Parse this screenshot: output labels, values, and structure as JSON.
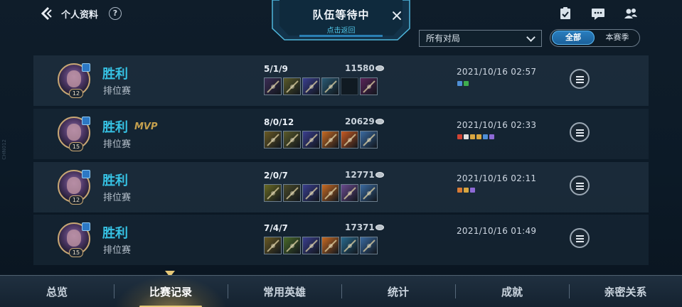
{
  "header": {
    "title": "个人资料",
    "help_label": "?"
  },
  "team_banner": {
    "title": "队伍等待中",
    "subtitle": "点击返回"
  },
  "filters": {
    "match_type_selected": "所有对局",
    "segments": [
      {
        "label": "全部",
        "active": true
      },
      {
        "label": "本赛季",
        "active": false
      }
    ]
  },
  "side_watermark": "CHN012",
  "matches": [
    {
      "result": "胜利",
      "mvp": "",
      "mode": "排位赛",
      "level": "12",
      "kda": "5/1/9",
      "gold": "11580",
      "date": "2021/10/16 02:57",
      "items": [
        "#3b2d55",
        "#5a5a2a",
        "#3a3e8e",
        "#2a5a73",
        "empty",
        "#5a2458"
      ],
      "badges": [
        "#4f8fd6",
        "#3fae4e"
      ]
    },
    {
      "result": "胜利",
      "mvp": "MVP",
      "mode": "排位赛",
      "level": "15",
      "kda": "8/0/12",
      "gold": "20629",
      "date": "2021/10/16 02:33",
      "items": [
        "#6a5a24",
        "#5a5a2a",
        "#3a3e8e",
        "#c86a22",
        "#c85a22",
        "#3a6aa0"
      ],
      "badges": [
        "#d24434",
        "#e0e0e0",
        "#d8a640",
        "#d8a640",
        "#4f8fd6",
        "#8e6ad6"
      ]
    },
    {
      "result": "胜利",
      "mvp": "",
      "mode": "排位赛",
      "level": "12",
      "kda": "2/0/7",
      "gold": "12771",
      "date": "2021/10/16 02:11",
      "items": [
        "#6a6a24",
        "#4a4a2a",
        "#3a3e8e",
        "#c86a22",
        "#6a4a8e",
        "#3a6aa0"
      ],
      "badges": [
        "#d87a34",
        "#d8a640",
        "#8e6ad6"
      ]
    },
    {
      "result": "胜利",
      "mvp": "",
      "mode": "排位赛",
      "level": "15",
      "kda": "7/4/7",
      "gold": "17371",
      "date": "2021/10/16 01:49",
      "items": [
        "#6a5a24",
        "#4a6a2a",
        "#3a3e8e",
        "#c86a22",
        "#2a6a8e",
        "#3a6aa0"
      ],
      "badges": []
    }
  ],
  "tabs": [
    {
      "label": "总览",
      "active": false
    },
    {
      "label": "比赛记录",
      "active": true
    },
    {
      "label": "常用英雄",
      "active": false
    },
    {
      "label": "统计",
      "active": false
    },
    {
      "label": "成就",
      "active": false
    },
    {
      "label": "亲密关系",
      "active": false
    }
  ],
  "colors": {
    "win": "#36c2e4",
    "mvp": "#c5a04e",
    "accent_gold": "#e6c878"
  },
  "icons": {
    "back": "back-chevron-icon",
    "help": "question-circle-icon",
    "close": "close-icon",
    "tasks": "task-clipboard-icon",
    "chat": "chat-bubble-icon",
    "friends": "friends-icon",
    "gold": "gold-coin-icon",
    "details": "list-details-icon",
    "party": "party-icon"
  }
}
